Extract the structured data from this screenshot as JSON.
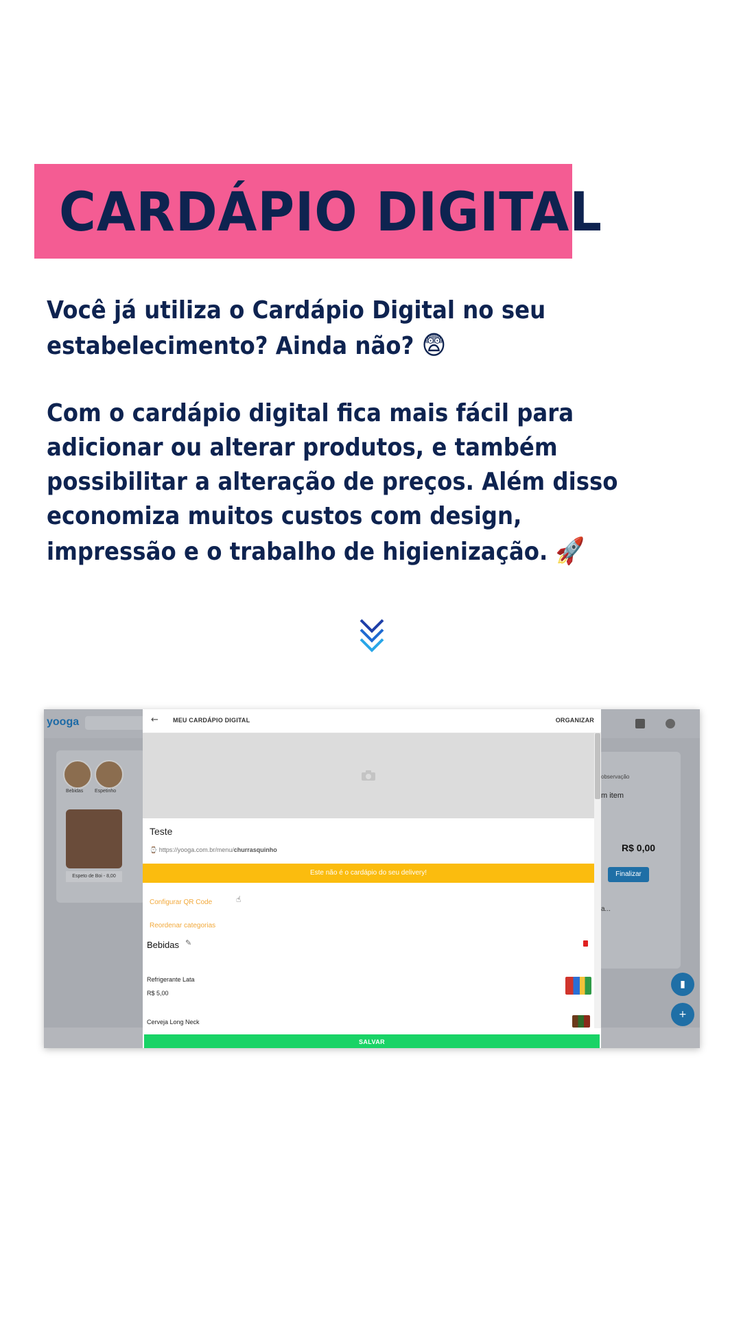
{
  "banner": {
    "title": "CARDÁPIO DIGITAL"
  },
  "intro": {
    "text": "Você já utiliza o Cardápio Digital no seu estabelecimento? Ainda não?",
    "emoji": "😨"
  },
  "body": {
    "text": "Com o cardápio digital fica mais fácil para adicionar ou alterar produtos, e também possibilitar a alteração de preços. Além disso economiza muitos custos com design, impressão e o trabalho de higienização.",
    "emoji": "🚀"
  },
  "colors": {
    "banner_bg": "#f45c93",
    "navy": "#0e2350",
    "chevron": "#1e88e5",
    "alert": "#fbbc0e",
    "save": "#19d366",
    "link": "#f2a93b"
  },
  "screenshot": {
    "app_logo": "yooga",
    "background": {
      "categories": [
        "Bebidas",
        "Espetinho"
      ],
      "food_item": "Espeto de Boi - 8,00",
      "observation": "observação",
      "item_text": "m item",
      "total": "R$ 0,00",
      "finalize_label": "Finalizar",
      "ellipsis_text": "a..."
    },
    "modal": {
      "back_icon": "arrow-left-icon",
      "title": "MEU CARDÁPIO DIGITAL",
      "organize_label": "ORGANIZAR",
      "store_name": "Teste",
      "url_prefix": "https://yooga.com.br/menu/",
      "url_slug": "churrasquinho",
      "alert_text": "Este não é o cardápio do seu delivery!",
      "links": [
        "Configurar QR Code",
        "Reordenar categorias"
      ],
      "category": "Bebidas",
      "products": [
        {
          "name": "Refrigerante Lata",
          "price": "R$ 5,00"
        },
        {
          "name": "Cerveja Long Neck",
          "price": ""
        }
      ],
      "save_label": "SALVAR"
    }
  }
}
